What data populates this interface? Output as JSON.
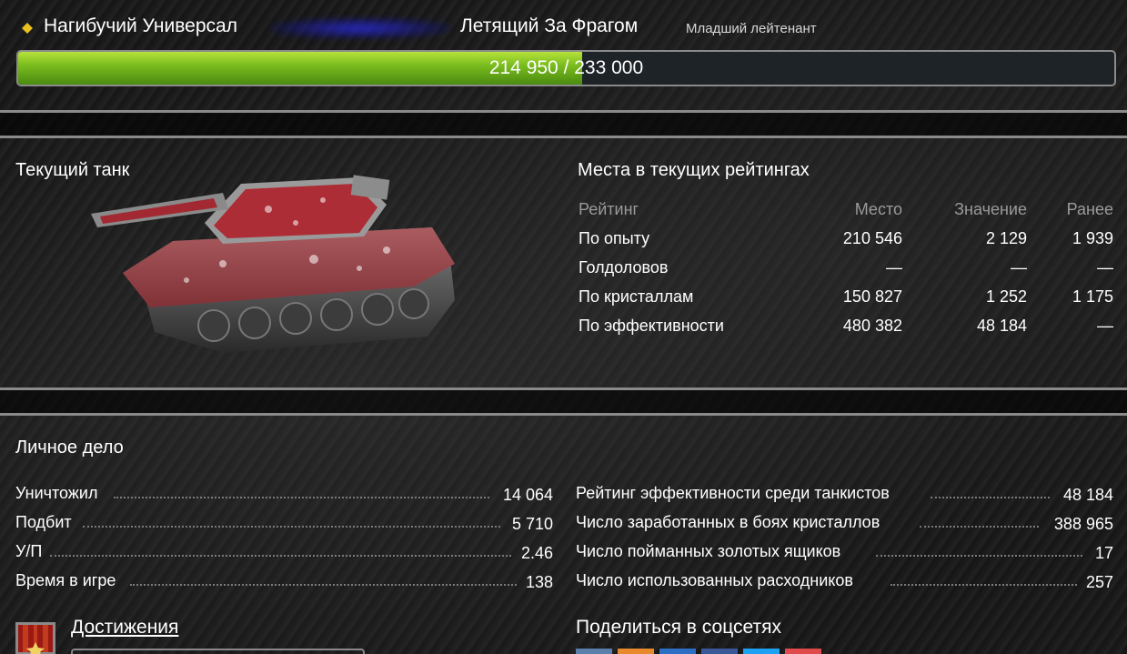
{
  "header": {
    "player_name": "Нагибучий Универсал",
    "nickname": "Летящий За Фрагом",
    "rank": "Младший лейтенант"
  },
  "experience": {
    "label": "214 950 / 233 000",
    "current": 214950,
    "max": 233000,
    "fill_color": "#7bbd1f"
  },
  "current_tank": {
    "title": "Текущий танк",
    "image_icon": "tank-image"
  },
  "ratings": {
    "title": "Места в текущих рейтингах",
    "columns": [
      "Рейтинг",
      "Место",
      "Значение",
      "Ранее"
    ],
    "rows": [
      {
        "name": "По опыту",
        "place": "210 546",
        "value": "2 129",
        "before": "1 939"
      },
      {
        "name": "Голдоловов",
        "place": "—",
        "value": "—",
        "before": "—"
      },
      {
        "name": "По кристаллам",
        "place": "150 827",
        "value": "1 252",
        "before": "1 175"
      },
      {
        "name": "По эффективности",
        "place": "480 382",
        "value": "48 184",
        "before": "—"
      }
    ]
  },
  "personal": {
    "title": "Личное дело",
    "left": [
      {
        "label": "Уничтожил",
        "value": "14 064"
      },
      {
        "label": "Подбит",
        "value": "5 710"
      },
      {
        "label": "У/П",
        "value": "2.46"
      },
      {
        "label": "Время в игре",
        "value": "138"
      }
    ],
    "right": [
      {
        "label": "Рейтинг эффективности среди танкистов",
        "value": "48 184"
      },
      {
        "label": "Число заработанных в боях кристаллов",
        "value": "388 965"
      },
      {
        "label": "Число пойманных золотых ящиков",
        "value": "17"
      },
      {
        "label": "Число использованных расходников",
        "value": "257"
      }
    ]
  },
  "achievements": {
    "link": "Достижения",
    "icon": "medal-icon"
  },
  "share": {
    "title": "Поделиться в соцсетях",
    "colors": [
      "#5b7fa8",
      "#e8892c",
      "#2d6fc4",
      "#3b5998",
      "#1da1f2",
      "#e04a4a"
    ]
  }
}
